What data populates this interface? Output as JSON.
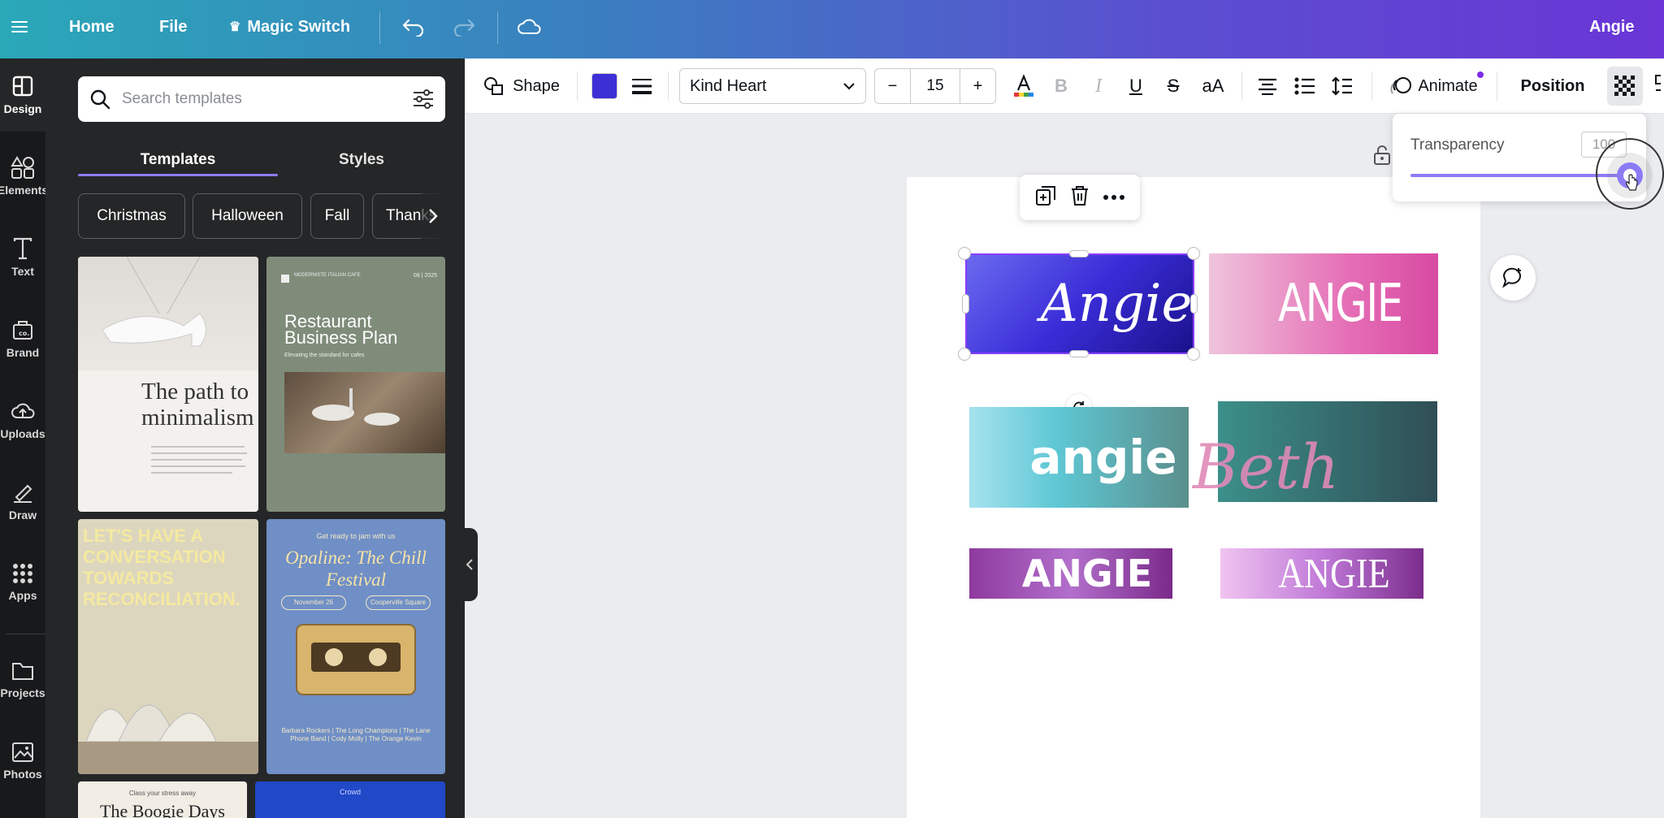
{
  "topbar": {
    "home_label": "Home",
    "file_label": "File",
    "magic_switch_label": "Magic Switch",
    "user_name": "Angie"
  },
  "rail": {
    "items": [
      {
        "label": "Design"
      },
      {
        "label": "Elements"
      },
      {
        "label": "Text"
      },
      {
        "label": "Brand"
      },
      {
        "label": "Uploads"
      },
      {
        "label": "Draw"
      },
      {
        "label": "Apps"
      },
      {
        "label": "Projects"
      },
      {
        "label": "Photos"
      }
    ]
  },
  "panel": {
    "search_placeholder": "Search templates",
    "tabs": [
      {
        "label": "Templates"
      },
      {
        "label": "Styles"
      }
    ],
    "chips": [
      {
        "label": "Christmas"
      },
      {
        "label": "Halloween"
      },
      {
        "label": "Fall"
      },
      {
        "label": "Thanks"
      }
    ],
    "templates": [
      {
        "text": "The path to minimalism"
      },
      {
        "header_left": "MODERNISTE ITALIAN CAFE",
        "header_right": "08 | 2025",
        "title": "Restaurant Business Plan",
        "subtitle": "Elevating the standard for cafes"
      },
      {
        "text": "LET'S HAVE A CONVERSATION TOWARDS RECONCILIATION."
      },
      {
        "top": "Get ready to jam with us",
        "title": "Opaline: The Chill Festival",
        "date": "November 26",
        "venue": "Cooperville Square",
        "lineup": "Barbara Rockers | The Long Champions | The Lane Phone Band | Cody Molly | The Orange Kevin"
      },
      {
        "top": "Class your stress away",
        "title": "The Boogie Days"
      },
      {
        "top": "Crowd"
      }
    ]
  },
  "toolbar": {
    "shape_label": "Shape",
    "shape_color": "#3d2fd6",
    "font_name": "Kind Heart",
    "font_size": "15",
    "minus": "−",
    "plus": "+",
    "bold": "B",
    "italic": "I",
    "underline": "U",
    "strike": "S",
    "case": "aA",
    "animate_label": "Animate",
    "position_label": "Position"
  },
  "transparency": {
    "label": "Transparency",
    "value": "100",
    "level_percent": 100
  },
  "canvas": {
    "logos": [
      {
        "text": "Angie"
      },
      {
        "text": "ANGIE"
      },
      {
        "text": "angie"
      },
      {
        "text": "Beth"
      },
      {
        "text": "ANGIE"
      },
      {
        "text": "ANGIE"
      }
    ]
  },
  "colors": {
    "accent": "#8b7cf6",
    "rail_bg": "#18191b",
    "panel_bg": "#252627",
    "canvas_bg": "#ebecf0"
  }
}
